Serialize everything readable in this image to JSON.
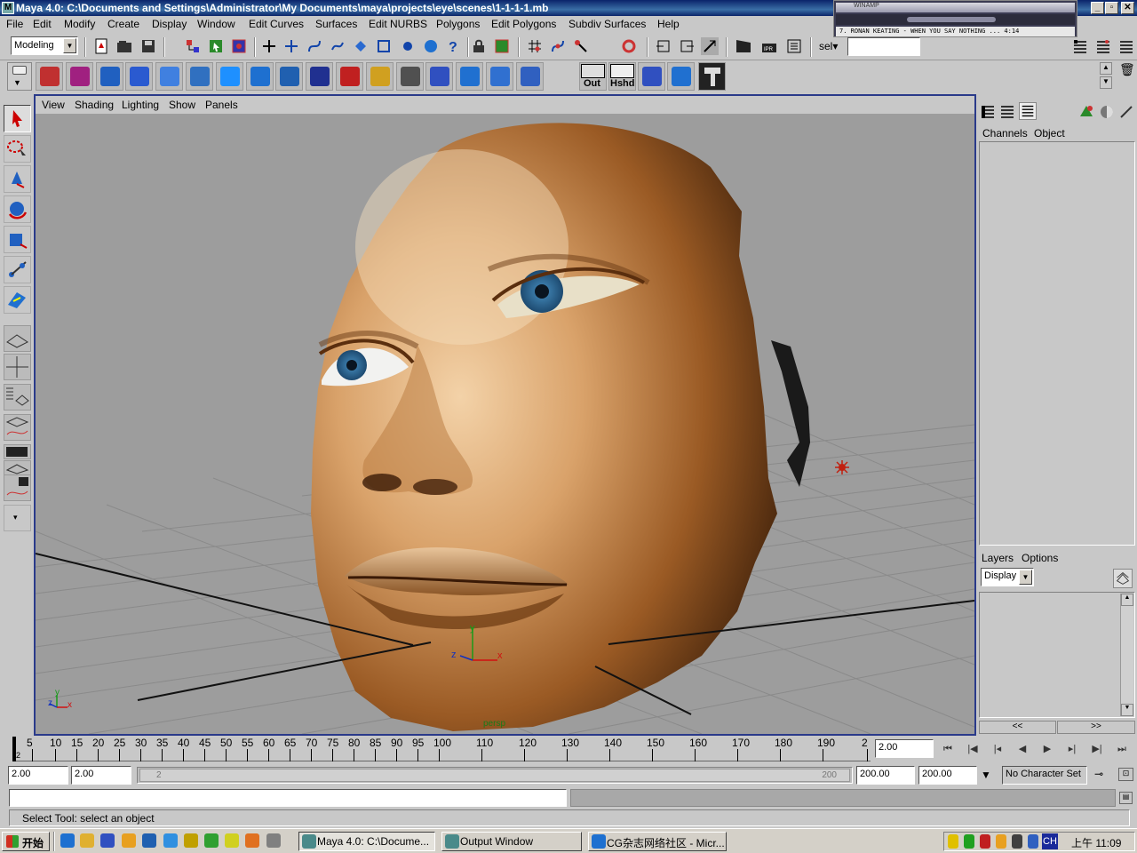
{
  "window": {
    "title": "Maya 4.0: C:\\Documents and Settings\\Administrator\\My Documents\\maya\\projects\\eye\\scenes\\1-1-1-1.mb",
    "buttons": [
      "_",
      "▫",
      "✕"
    ]
  },
  "winamp": {
    "title": "WINAMP",
    "song": "7. RONAN KEATING - WHEN YOU SAY NOTHING ...  4:14"
  },
  "menu": [
    "File",
    "Edit",
    "Modify",
    "Create",
    "Display",
    "Window",
    "Edit Curves",
    "Surfaces",
    "Edit NURBS",
    "Polygons",
    "Edit Polygons",
    "Subdiv Surfaces",
    "Help"
  ],
  "statusline": {
    "mode": "Modeling",
    "sel_label": "sel▾",
    "sel_value": ""
  },
  "shelf": {
    "icon_colors": [
      "#c03030",
      "#a02080",
      "#2060c0",
      "#2a5ad0",
      "#4080e0",
      "#3070c0",
      "#1e90ff",
      "#1e70d0",
      "#2060b0",
      "#203090",
      "#c02020",
      "#d0a020",
      "#505050",
      "#3050c0",
      "#2070d0",
      "#3070d0",
      "#3060c0"
    ],
    "out_label": "Out",
    "hshd_label": "Hshd"
  },
  "viewport": {
    "menu": [
      "View",
      "Shading",
      "Lighting",
      "Show",
      "Panels"
    ],
    "camera_label": "persp",
    "axis_x": "x",
    "axis_y": "y",
    "axis_z": "z"
  },
  "channelbox": {
    "header": [
      "Channels",
      "Object"
    ]
  },
  "layers": {
    "header": [
      "Layers",
      "Options"
    ],
    "display_select": "Display",
    "scroll_left": "<<",
    "scroll_right": ">>"
  },
  "timeslider": {
    "ticks": [
      "5",
      "10",
      "15",
      "20",
      "25",
      "30",
      "35",
      "40",
      "45",
      "50",
      "55",
      "60",
      "65",
      "70",
      "75",
      "80",
      "85",
      "90",
      "95",
      "100",
      "110",
      "120",
      "130",
      "140",
      "150",
      "160",
      "170",
      "180",
      "190",
      "2"
    ],
    "start_marker": "2",
    "current_frame": "2.00"
  },
  "rangeslider": {
    "start_time": "2.00",
    "playback_start": "2.00",
    "range_start_label": "2",
    "range_end_label": "200",
    "playback_end": "200.00",
    "end_time": "200.00",
    "character_set": "No Character Set"
  },
  "helpline": {
    "text": "Select Tool: select an object"
  },
  "taskbar": {
    "start": "开始",
    "tasks": [
      "Maya 4.0: C:\\Docume...",
      "Output Window",
      "CG杂志网络社区 - Micr..."
    ],
    "lang": "CH",
    "clock": "上午 11:09"
  }
}
